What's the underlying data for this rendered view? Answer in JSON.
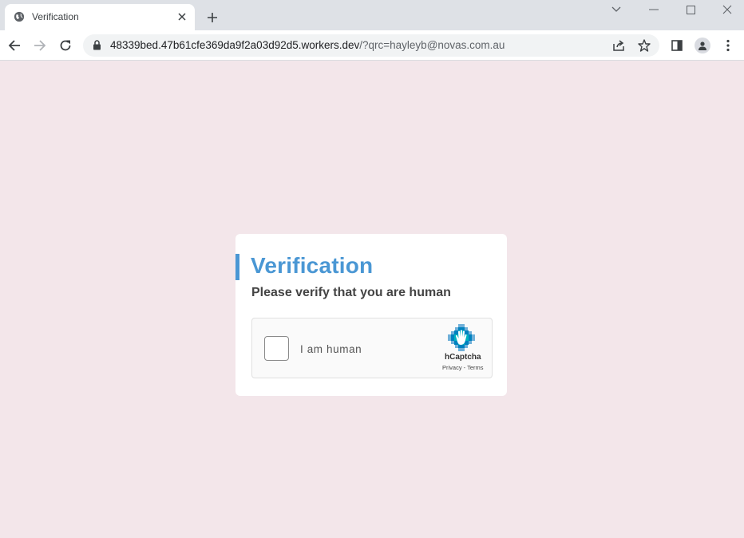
{
  "browser": {
    "tab_title": "Verification",
    "url_host": "48339bed.47b61cfe369da9f2a03d92d5.workers.dev",
    "url_rest": "/?qrc=hayleyb@novas.com.au"
  },
  "page": {
    "heading": "Verification",
    "subheading": "Please verify that you are human",
    "accent_color": "#4a97d4",
    "background_color": "#f3e6ea"
  },
  "captcha": {
    "label": "I am human",
    "brand": "hCaptcha",
    "privacy_link": "Privacy",
    "separator": " - ",
    "terms_link": "Terms"
  }
}
